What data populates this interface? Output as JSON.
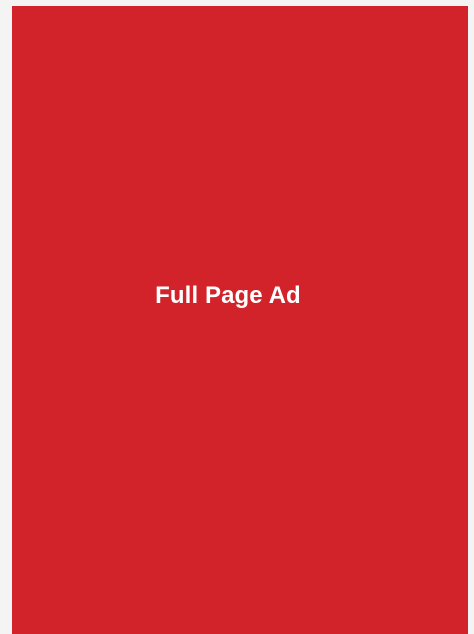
{
  "ad": {
    "label": "Full Page Ad",
    "background_color": "#d2232a",
    "text_color": "#ffffff"
  },
  "page": {
    "background_color": "#f4f4f4"
  }
}
